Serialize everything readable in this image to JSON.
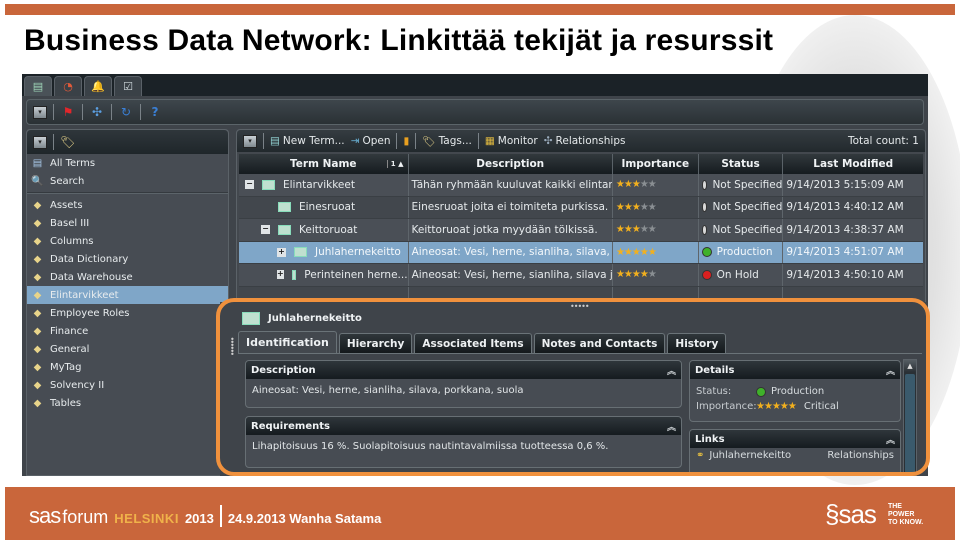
{
  "slide": {
    "title": "Business Data Network: Linkittää tekijät ja resurssit"
  },
  "app": {
    "tabs": [
      {
        "icon": "terms-icon",
        "glyph": "▤"
      },
      {
        "icon": "dashboard-icon",
        "glyph": "◔"
      },
      {
        "icon": "bell-icon",
        "glyph": "🔔"
      },
      {
        "icon": "checklist-icon",
        "glyph": "☑"
      }
    ],
    "main_toolbar": [
      {
        "icon": "menu-dropdown-icon",
        "glyph": "▾"
      },
      {
        "icon": "flag-icon",
        "glyph": "⚑"
      },
      {
        "icon": "relationships-icon",
        "glyph": "✣"
      },
      {
        "icon": "refresh-icon",
        "glyph": "↻"
      },
      {
        "icon": "help-icon",
        "glyph": "?"
      }
    ],
    "left_panel": {
      "nav": [
        {
          "label": "All Terms",
          "icon": "all-terms-icon"
        },
        {
          "label": "Search",
          "icon": "search-icon"
        }
      ],
      "tags": [
        {
          "label": "Assets",
          "selected": false
        },
        {
          "label": "Basel III",
          "selected": false
        },
        {
          "label": "Columns",
          "selected": false
        },
        {
          "label": "Data Dictionary",
          "selected": false
        },
        {
          "label": "Data Warehouse",
          "selected": false
        },
        {
          "label": "Elintarvikkeet",
          "selected": true
        },
        {
          "label": "Employee Roles",
          "selected": false
        },
        {
          "label": "Finance",
          "selected": false
        },
        {
          "label": "General",
          "selected": false
        },
        {
          "label": "MyTag",
          "selected": false
        },
        {
          "label": "Solvency II",
          "selected": false
        },
        {
          "label": "Tables",
          "selected": false
        }
      ]
    },
    "grid_toolbar": {
      "new_term": "New Term...",
      "open": "Open",
      "tags": "Tags...",
      "monitor": "Monitor",
      "relationships": "Relationships",
      "total_count": "Total count: 1"
    },
    "grid": {
      "columns": [
        "Term Name",
        "Description",
        "Importance",
        "Status",
        "Last Modified"
      ],
      "sort_indicator": "1 ▲",
      "rows": [
        {
          "name": "Elintarvikkeet",
          "indent": 0,
          "expander": "−",
          "description": "Tähän ryhmään kuuluvat kaikki elintarvi...",
          "importance": 3,
          "status": "Not Specified",
          "status_color": "#d8d8d8",
          "modified": "9/14/2013 5:15:09 AM",
          "selected": false
        },
        {
          "name": "Einesruoat",
          "indent": 1,
          "expander": "",
          "description": "Einesruoat joita ei toimiteta purkissa.",
          "importance": 3,
          "status": "Not Specified",
          "status_color": "#d8d8d8",
          "modified": "9/14/2013 4:40:12 AM",
          "selected": false
        },
        {
          "name": "Keittoruoat",
          "indent": 1,
          "expander": "−",
          "description": "Keittoruoat jotka myydään tölkissä.",
          "importance": 3,
          "status": "Not Specified",
          "status_color": "#d8d8d8",
          "modified": "9/14/2013 4:38:37 AM",
          "selected": false
        },
        {
          "name": "Juhlahernekeitto",
          "indent": 2,
          "expander": "+",
          "description": "Aineosat: Vesi, herne, sianliha, silava, por...",
          "importance": 5,
          "status": "Production",
          "status_color": "#3fb12a",
          "modified": "9/14/2013 4:51:07 AM",
          "selected": true
        },
        {
          "name": "Perinteinen herne...",
          "indent": 2,
          "expander": "+",
          "description": "Aineosat: Vesi, herne, sianliha, silava ja s...",
          "importance": 4,
          "status": "On Hold",
          "status_color": "#d92020",
          "modified": "9/14/2013 4:50:10 AM",
          "selected": false
        }
      ]
    },
    "detail": {
      "title": "Juhlahernekeitto",
      "tabs": [
        "Identification",
        "Hierarchy",
        "Associated Items",
        "Notes and Contacts",
        "History"
      ],
      "active_tab": 0,
      "description": {
        "header": "Description",
        "text": "Aineosat: Vesi, herne, sianliha, silava, porkkana, suola"
      },
      "requirements": {
        "header": "Requirements",
        "text": "Lihapitoisuus 16 %. Suolapitoisuus nautintavalmiissa tuotteessa 0,6 %."
      },
      "details": {
        "header": "Details",
        "status_label": "Status:",
        "status_value": "Production",
        "status_color": "#3fb12a",
        "importance_label": "Importance:",
        "importance_stars": 5,
        "importance_value": "Critical"
      },
      "links": {
        "header": "Links",
        "item": "Juhlahernekeitto",
        "type": "Relationships"
      }
    }
  },
  "footer": {
    "sas": "sas",
    "forum": "forum",
    "city": "HELSINKI",
    "year": "2013",
    "date_venue": "24.9.2013 Wanha Satama",
    "logo": "sas",
    "tagline": [
      "THE",
      "POWER",
      "TO KNOW."
    ]
  },
  "colors": {
    "accent_orange": "#c9663b",
    "highlight_frame": "#f0913d",
    "selection_blue": "#7fa6c8",
    "star_gold": "#f2b01e"
  }
}
